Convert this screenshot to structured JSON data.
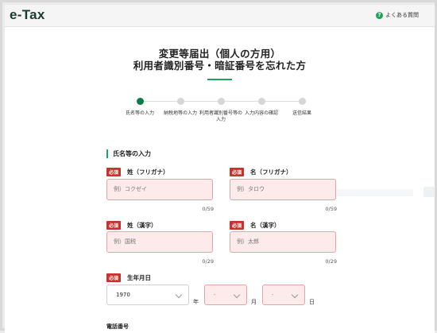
{
  "header": {
    "logo": "e-Tax",
    "faq_label": "よくある質問",
    "faq_icon": "question-icon"
  },
  "title": {
    "line1": "変更等届出（個人の方用）",
    "line2": "利用者識別番号・暗証番号を忘れた方"
  },
  "stepper": {
    "current_index": 0,
    "steps": [
      {
        "label": "氏名等の入力"
      },
      {
        "label": "納税地等の入力"
      },
      {
        "label": "利用者識別番号等の入力"
      },
      {
        "label": "入力内容の確認"
      },
      {
        "label": "送信結果"
      }
    ]
  },
  "section": {
    "title": "氏名等の入力"
  },
  "required_badge": "必須",
  "fields": {
    "sei_kana": {
      "label": "姓（フリガナ）",
      "placeholder": "例）コクゼイ",
      "counter": "0/59"
    },
    "mei_kana": {
      "label": "名（フリガナ）",
      "placeholder": "例）タロウ",
      "counter": "0/59"
    },
    "sei_kanji": {
      "label": "姓（漢字）",
      "placeholder": "例）国税",
      "counter": "0/29"
    },
    "mei_kanji": {
      "label": "名（漢字）",
      "placeholder": "例）太郎",
      "counter": "0/29"
    }
  },
  "birthdate": {
    "label": "生年月日",
    "year_value": "1970",
    "month_value": "-",
    "day_value": "-",
    "year_unit": "年",
    "month_unit": "月",
    "day_unit": "日"
  },
  "phone": {
    "label": "電話番号"
  },
  "colors": {
    "accent": "#1fa35c",
    "required": "#c8312c",
    "step_active": "#0b7a4a",
    "input_error_bg": "#fdeaea"
  }
}
